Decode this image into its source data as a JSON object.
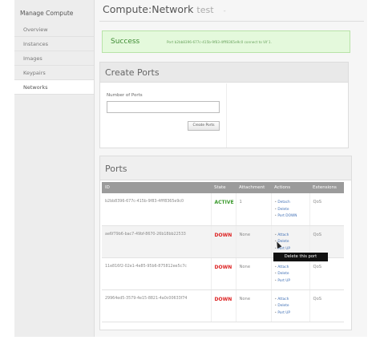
{
  "sidebar": {
    "title": "Manage Compute",
    "items": [
      {
        "label": "Overview"
      },
      {
        "label": "Instances"
      },
      {
        "label": "Images"
      },
      {
        "label": "Keypairs"
      },
      {
        "label": "Networks"
      }
    ]
  },
  "header": {
    "title": "Compute:Network",
    "subtitle": "test",
    "dash": "-"
  },
  "alert": {
    "label": "Success",
    "message": "Port b2bb8396-677c-415b-9f83-4fff8365e9c0 connect to Vif 1."
  },
  "create_ports": {
    "heading": "Create Ports",
    "field_label": "Number of Ports",
    "field_value": "",
    "button_label": "Create Ports"
  },
  "ports": {
    "heading": "Ports",
    "columns": [
      "ID",
      "State",
      "Attachment",
      "Actions",
      "Extensions"
    ],
    "rows": [
      {
        "id": "b2bb8396-677c-415b-9f83-4fff8365e9c0",
        "state": "ACTIVE",
        "attachment": "1",
        "actions": [
          "Detach",
          "Delete",
          "Port DOWN"
        ],
        "extension": "QoS"
      },
      {
        "id": "ae6f79b6-bac7-49bf-8670-26b18bb22533",
        "state": "DOWN",
        "attachment": "None",
        "actions": [
          "Attach",
          "Delete",
          "Port UP"
        ],
        "extension": "QoS"
      },
      {
        "id": "11e816f2-02e1-4e85-95b6-875812ee5c7c",
        "state": "DOWN",
        "attachment": "None",
        "actions": [
          "Attach",
          "Delete",
          "Port UP"
        ],
        "extension": "QoS"
      },
      {
        "id": "29964ed5-3579-4e15-8821-4a0c00633f74",
        "state": "DOWN",
        "attachment": "None",
        "actions": [
          "Attach",
          "Delete",
          "Port UP"
        ],
        "extension": "QoS"
      }
    ]
  },
  "tooltip": "Delete this port"
}
